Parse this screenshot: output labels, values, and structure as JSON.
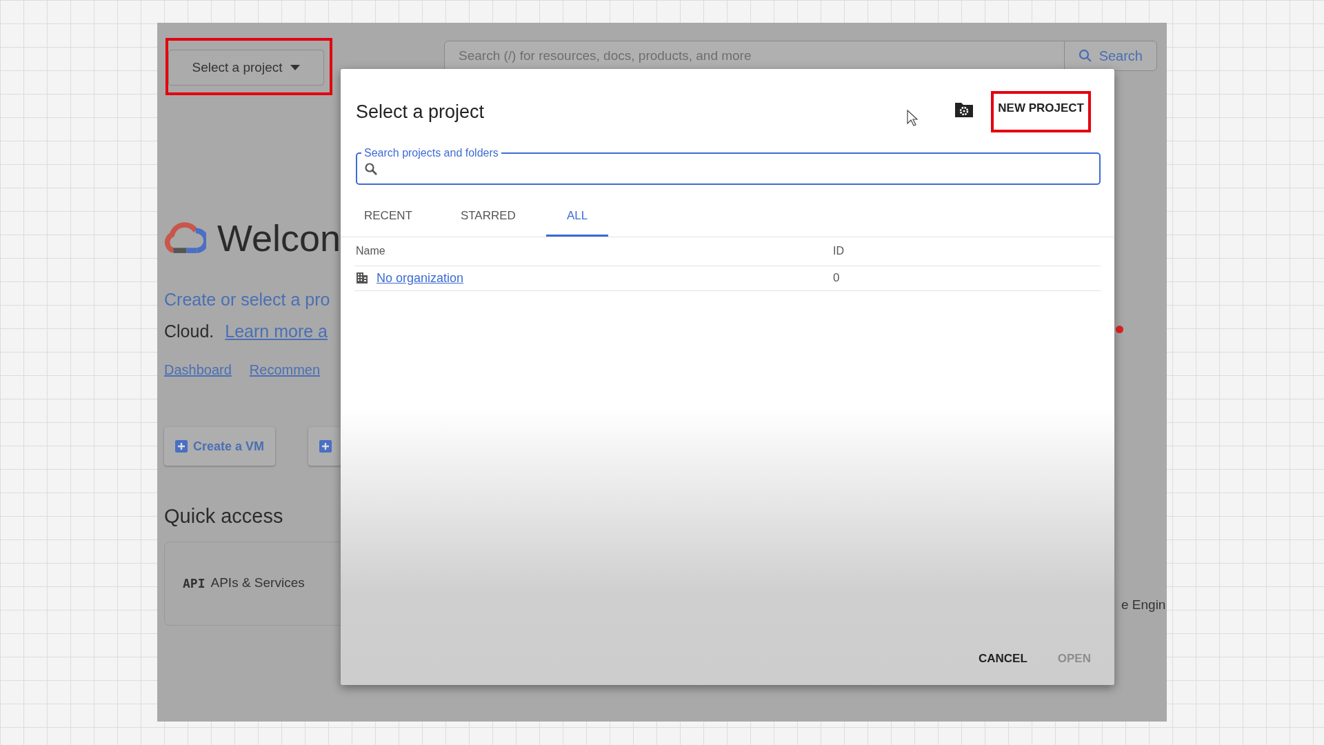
{
  "top_bar": {
    "project_selector": {
      "label": "Select a project",
      "highlighted": true
    },
    "search": {
      "placeholder": "Search (/) for resources, docs, products, and more",
      "button": "Search"
    }
  },
  "welcome": {
    "title": "Welcon",
    "line_1": "Create or select a pro",
    "line_2_text": "Cloud.",
    "line_2_link": "Learn more a",
    "links": [
      "Dashboard",
      "Recommen"
    ],
    "actions": [
      {
        "kind": "text",
        "label": "Create a VM"
      },
      {
        "kind": "icon"
      }
    ]
  },
  "quick_access": {
    "title": "Quick access",
    "cards": [
      {
        "icon_text": "API",
        "label": "APIs & Services"
      }
    ],
    "right_card": "e Engin"
  },
  "dialog": {
    "title": "Select a project",
    "new_project": {
      "label": "NEW PROJECT",
      "highlighted": true
    },
    "search": {
      "label": "Search projects and folders"
    },
    "tabs": [
      {
        "label": "RECENT",
        "selected": false
      },
      {
        "label": "STARRED",
        "selected": false
      },
      {
        "label": "ALL",
        "selected": true
      }
    ],
    "table": {
      "columns": [
        "Name",
        "ID"
      ],
      "rows": [
        {
          "name": "No organization",
          "id": "0"
        }
      ]
    },
    "buttons": [
      {
        "label": "CANCEL",
        "disabled": false
      },
      {
        "label": "OPEN",
        "disabled": true
      }
    ]
  }
}
